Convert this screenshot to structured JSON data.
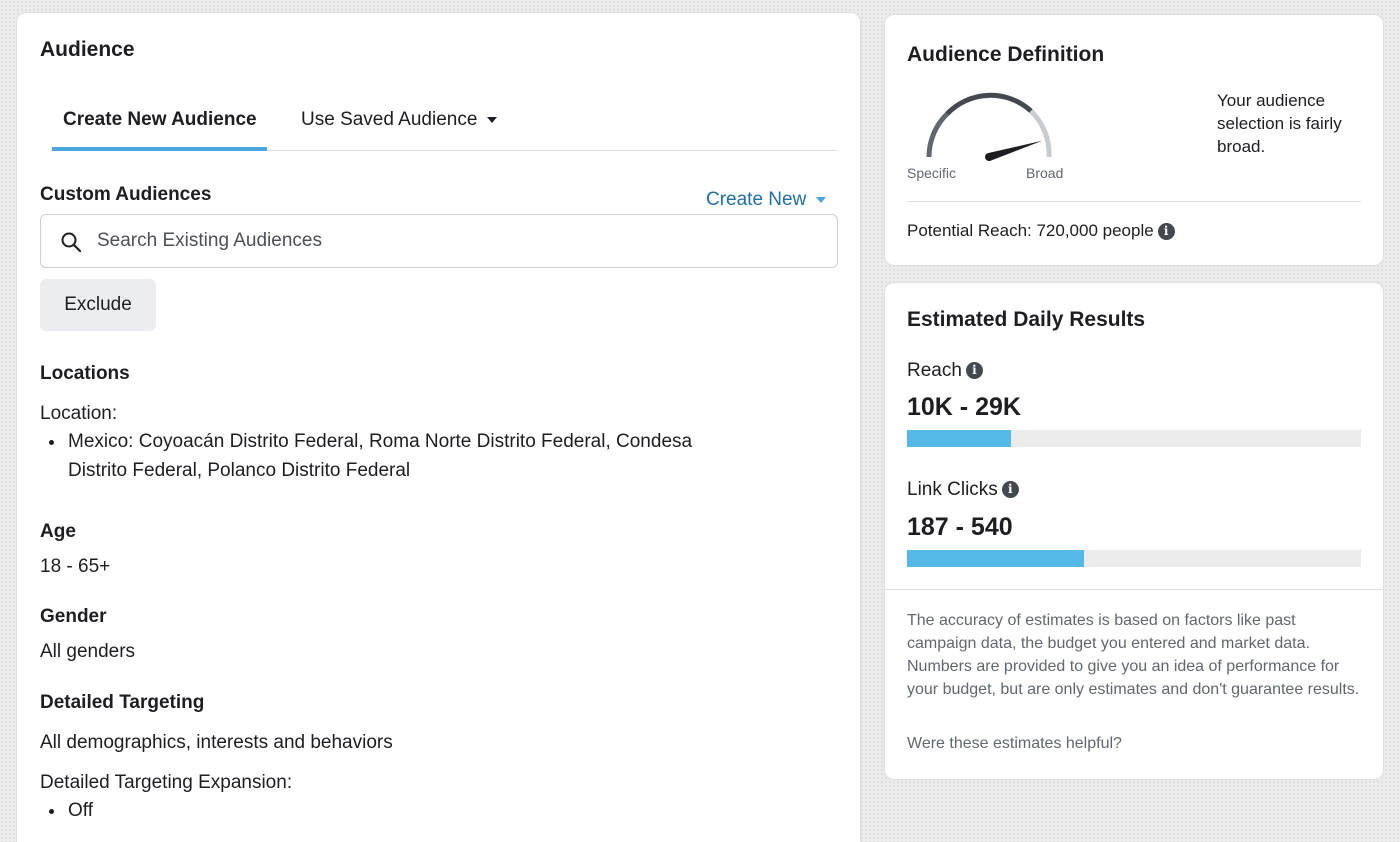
{
  "audience": {
    "title": "Audience",
    "tabs": {
      "create_new": "Create New Audience",
      "use_saved": "Use Saved Audience"
    },
    "custom_audiences": {
      "heading": "Custom Audiences",
      "create_new": "Create New",
      "search_placeholder": "Search Existing Audiences",
      "exclude": "Exclude"
    },
    "locations": {
      "heading": "Locations",
      "label": "Location:",
      "items": [
        "Mexico: Coyoacán Distrito Federal, Roma Norte Distrito Federal, Condesa",
        "Distrito Federal, Polanco Distrito Federal"
      ]
    },
    "age": {
      "heading": "Age",
      "value": "18 - 65+"
    },
    "gender": {
      "heading": "Gender",
      "value": "All genders"
    },
    "detailed_targeting": {
      "heading": "Detailed Targeting",
      "value": "All demographics, interests and behaviors",
      "expansion_label": "Detailed Targeting Expansion:",
      "expansion_items": [
        "Off"
      ]
    }
  },
  "definition": {
    "title": "Audience Definition",
    "specific_label": "Specific",
    "broad_label": "Broad",
    "gauge_level": 0.85,
    "description": "Your audience selection is fairly broad.",
    "potential_reach": "Potential Reach: 720,000 people"
  },
  "estimates": {
    "title": "Estimated Daily Results",
    "reach": {
      "label": "Reach",
      "value": "10K - 29K",
      "fill": 0.23
    },
    "link_clicks": {
      "label": "Link Clicks",
      "value": "187 - 540",
      "fill": 0.39
    },
    "disclaimer": "The accuracy of estimates is based on factors like past campaign data, the budget you entered and market data. Numbers are provided to give you an idea of performance for your budget, but are only estimates and don't guarantee results.",
    "feedback": "Were these estimates helpful?"
  },
  "colors": {
    "accent": "#4aa6dd",
    "bar_fill": "#56b8e6",
    "link": "#216fa0"
  }
}
